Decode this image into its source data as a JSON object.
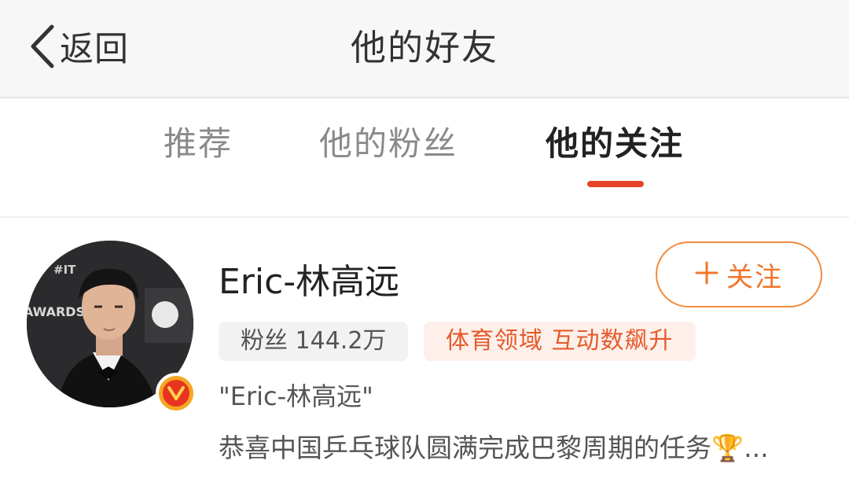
{
  "header": {
    "back_label": "返回",
    "title": "他的好友"
  },
  "tabs": [
    {
      "label": "推荐",
      "active": false
    },
    {
      "label": "他的粉丝",
      "active": false
    },
    {
      "label": "他的关注",
      "active": true
    }
  ],
  "user": {
    "name": "Eric-林高远",
    "fans_tag": "粉丝 144.2万",
    "domain_tag": "体育领域 互动数飙升",
    "remark": "\"Eric-林高远\"",
    "bio": "恭喜中国乒乓球队圆满完成巴黎周期的任务🏆...",
    "follow_label": "关注",
    "verified": true,
    "avatar_text_1": "#IT",
    "avatar_text_2": "AWARDS"
  },
  "colors": {
    "accent": "#e6442a",
    "follow": "#f0762a",
    "domain_tag_bg": "#fdf0ea"
  },
  "icons": {
    "back": "chevron-left-icon",
    "follow": "plus-icon",
    "verified": "verified-v-icon"
  }
}
